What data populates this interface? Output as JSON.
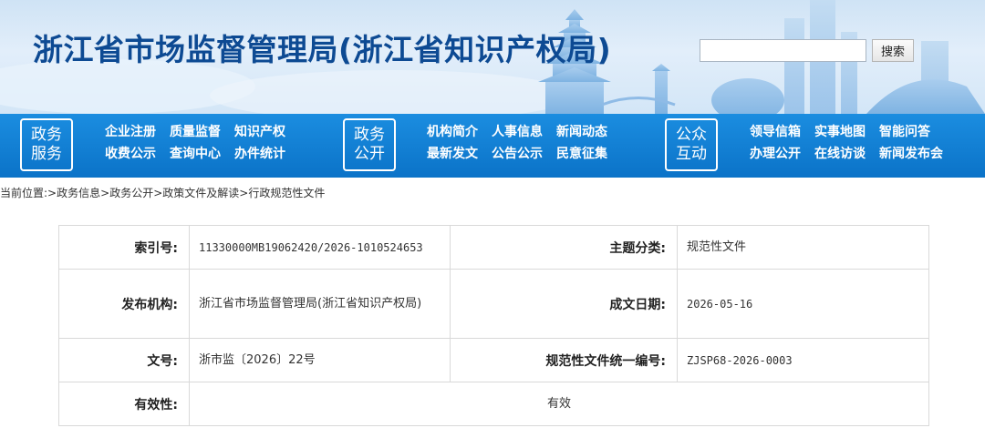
{
  "header": {
    "site_title": "浙江省市场监督管理局(浙江省知识产权局)",
    "search": {
      "placeholder": "",
      "button_label": "搜索"
    }
  },
  "nav": {
    "groups": [
      {
        "badge": [
          "政务",
          "服务"
        ],
        "links": [
          "企业注册",
          "质量监督",
          "知识产权",
          "收费公示",
          "查询中心",
          "办件统计"
        ]
      },
      {
        "badge": [
          "政务",
          "公开"
        ],
        "links": [
          "机构简介",
          "人事信息",
          "新闻动态",
          "最新发文",
          "公告公示",
          "民意征集"
        ]
      },
      {
        "badge": [
          "公众",
          "互动"
        ],
        "links": [
          "领导信箱",
          "实事地图",
          "智能问答",
          "办理公开",
          "在线访谈",
          "新闻发布会"
        ]
      }
    ]
  },
  "breadcrumb": {
    "prefix": "当前位置:",
    "items": [
      "政务信息",
      "政务公开",
      "政策文件及解读",
      "行政规范性文件"
    ],
    "separator": ">"
  },
  "info": {
    "index_label": "索引号:",
    "index_value": "11330000MB19062420/2026-1010524653",
    "topic_label": "主题分类:",
    "topic_value": "规范性文件",
    "publisher_label": "发布机构:",
    "publisher_value": "浙江省市场监督管理局(浙江省知识产权局)",
    "date_label": "成文日期:",
    "date_value": "2026-05-16",
    "docno_label": "文号:",
    "docno_value": "浙市监〔2026〕22号",
    "code_label": "规范性文件统一编号:",
    "code_value": "ZJSP68-2026-0003",
    "validity_label": "有效性:",
    "validity_value": "有效"
  },
  "colors": {
    "title_blue": "#0d4a93",
    "nav_blue": "#0b73c8",
    "border_gray": "#d9d9d9"
  }
}
